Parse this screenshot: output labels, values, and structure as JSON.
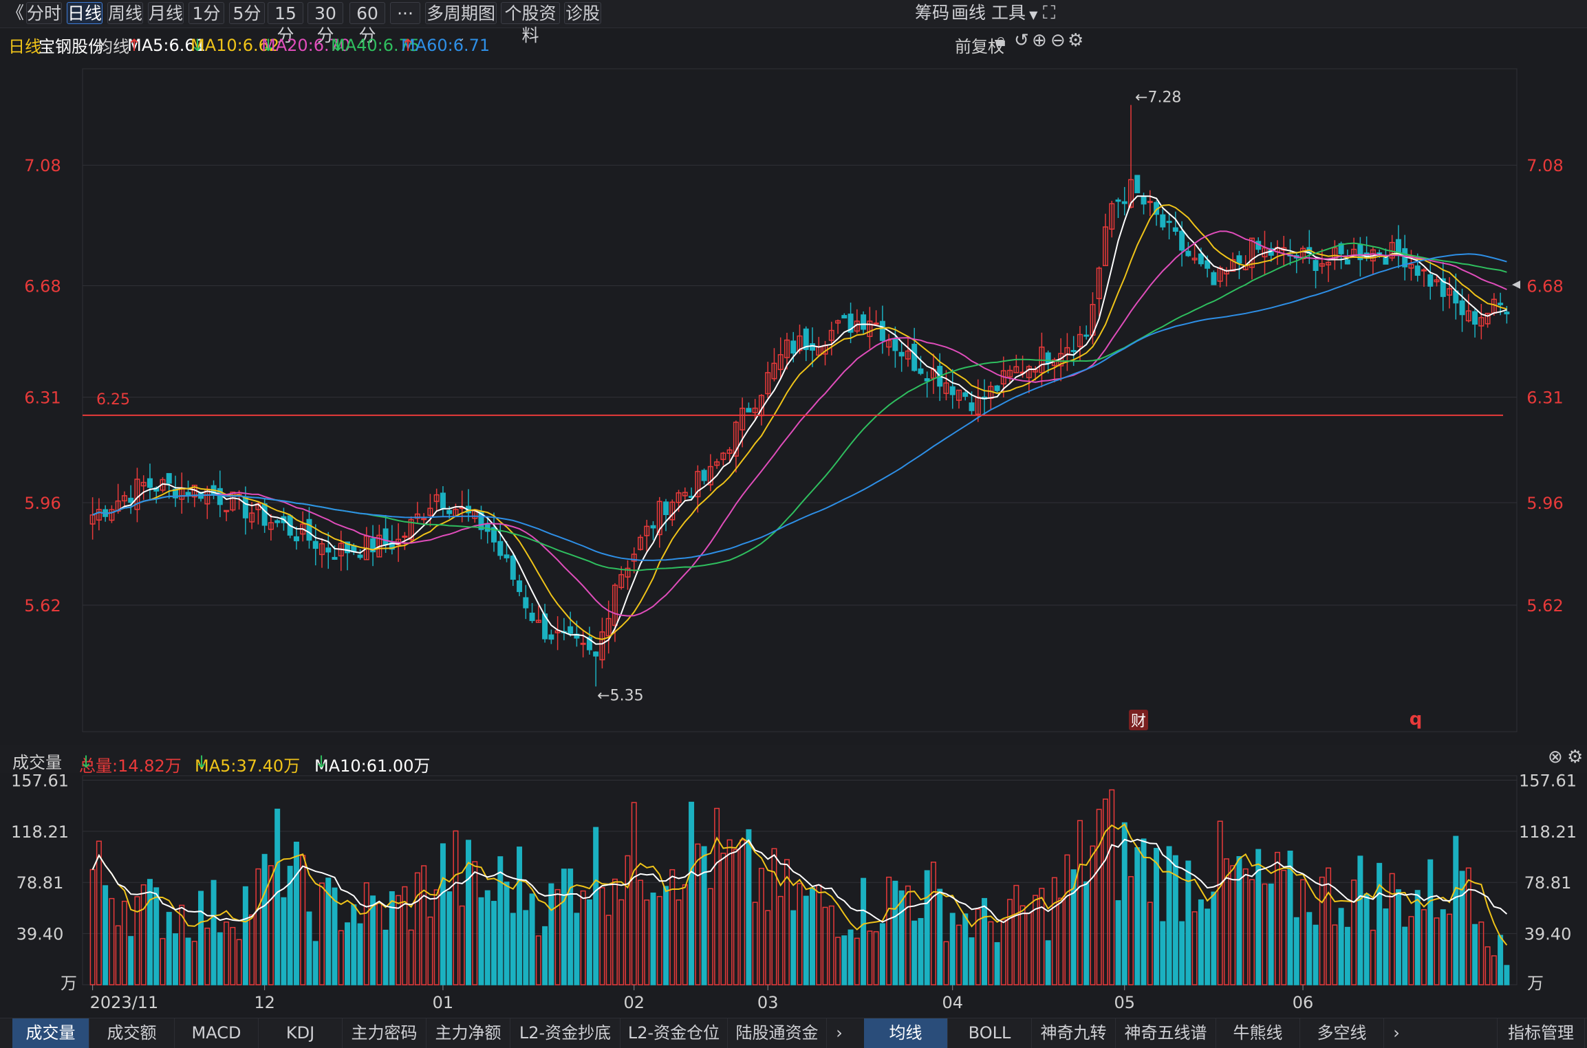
{
  "toolbar": {
    "back": "《",
    "tabs": [
      "分时",
      "日线",
      "周线",
      "月线",
      "1分",
      "5分",
      "15分",
      "30分",
      "60分",
      "···",
      "多周期图",
      "个股资料",
      "诊股"
    ],
    "active_tab": "日线",
    "right": [
      "筹码",
      "画线",
      "工具"
    ]
  },
  "info": {
    "period": "日线",
    "stock": "宝钢股份",
    "ma_label": "均线",
    "ma5": "MA5:6.61",
    "ma10": "MA10:6.62",
    "ma20": "MA20:6.70",
    "ma40": "MA40:6.75",
    "ma60": "MA60:6.71",
    "fq": "前复权"
  },
  "colors": {
    "up": "#e83a3a",
    "down": "#1bb1c1",
    "ma5": "#ffffff",
    "ma10": "#f0c419",
    "ma20": "#e04dbb",
    "ma40": "#2fbf5f",
    "ma60": "#2e8fe6",
    "bg": "#1b1c20"
  },
  "price_axis": [
    "7.08",
    "6.68",
    "6.31",
    "5.96",
    "5.62"
  ],
  "annotations": {
    "high": "←7.28",
    "low": "←5.35",
    "line": "6.25",
    "cai": "财",
    "q": "q"
  },
  "volume": {
    "label": "成交量",
    "total": "总量:14.82万",
    "ma5": "MA5:37.40万",
    "ma10": "MA10:61.00万",
    "axis": [
      "157.61",
      "118.21",
      "78.81",
      "39.40",
      "万"
    ]
  },
  "xaxis": [
    "2023/11",
    "12",
    "01",
    "02",
    "03",
    "04",
    "05",
    "06"
  ],
  "bottom_tabs_left": [
    "成交量",
    "成交额",
    "MACD",
    "KDJ",
    "主力密码",
    "主力净额",
    "L2-资金抄底",
    "L2-资金仓位",
    "陆股通资金"
  ],
  "bottom_tabs_right": [
    "均线",
    "BOLL",
    "神奇九转",
    "神奇五线谱",
    "牛熊线",
    "多空线"
  ],
  "bottom_right": "指标管理",
  "chart_data": {
    "type": "candlestick",
    "title": "宝钢股份 日线",
    "price_ylim": [
      5.2,
      7.4
    ],
    "price_ticks": [
      7.08,
      6.68,
      6.31,
      5.96,
      5.62
    ],
    "high_label": 7.28,
    "low_label": 5.35,
    "hline": 6.25,
    "ma_last": {
      "MA5": 6.61,
      "MA10": 6.62,
      "MA20": 6.7,
      "MA40": 6.75,
      "MA60": 6.71
    },
    "volume_unit": "万",
    "volume_ylim": [
      0,
      160
    ],
    "volume_ticks": [
      157.61,
      118.21,
      78.81,
      39.4
    ],
    "close_anchors": [
      [
        0,
        5.92
      ],
      [
        8,
        6.02
      ],
      [
        18,
        6.0
      ],
      [
        30,
        5.88
      ],
      [
        38,
        5.8
      ],
      [
        48,
        5.83
      ],
      [
        54,
        5.99
      ],
      [
        62,
        5.87
      ],
      [
        70,
        5.55
      ],
      [
        79,
        5.44
      ],
      [
        82,
        5.7
      ],
      [
        90,
        5.96
      ],
      [
        97,
        6.05
      ],
      [
        103,
        6.28
      ],
      [
        109,
        6.47
      ],
      [
        115,
        6.52
      ],
      [
        122,
        6.58
      ],
      [
        128,
        6.44
      ],
      [
        133,
        6.38
      ],
      [
        139,
        6.29
      ],
      [
        145,
        6.4
      ],
      [
        152,
        6.48
      ],
      [
        156,
        6.52
      ],
      [
        160,
        6.95
      ],
      [
        163,
        7.0
      ],
      [
        170,
        6.83
      ],
      [
        176,
        6.68
      ],
      [
        182,
        6.8
      ],
      [
        188,
        6.78
      ],
      [
        194,
        6.76
      ],
      [
        200,
        6.8
      ],
      [
        206,
        6.78
      ],
      [
        212,
        6.66
      ],
      [
        216,
        6.57
      ],
      [
        222,
        6.62
      ]
    ],
    "volume_anchors": [
      [
        0,
        85
      ],
      [
        8,
        60
      ],
      [
        16,
        55
      ],
      [
        22,
        60
      ],
      [
        26,
        70
      ],
      [
        30,
        104
      ],
      [
        34,
        58
      ],
      [
        40,
        62
      ],
      [
        46,
        55
      ],
      [
        50,
        65
      ],
      [
        56,
        90
      ],
      [
        62,
        70
      ],
      [
        66,
        82
      ],
      [
        72,
        60
      ],
      [
        76,
        90
      ],
      [
        82,
        95
      ],
      [
        88,
        102
      ],
      [
        92,
        108
      ],
      [
        96,
        105
      ],
      [
        100,
        90
      ],
      [
        104,
        82
      ],
      [
        108,
        70
      ],
      [
        114,
        62
      ],
      [
        118,
        58
      ],
      [
        124,
        64
      ],
      [
        128,
        75
      ],
      [
        132,
        68
      ],
      [
        136,
        52
      ],
      [
        140,
        48
      ],
      [
        146,
        55
      ],
      [
        150,
        60
      ],
      [
        154,
        85
      ],
      [
        158,
        120
      ],
      [
        162,
        98
      ],
      [
        166,
        90
      ],
      [
        170,
        82
      ],
      [
        176,
        90
      ],
      [
        182,
        76
      ],
      [
        188,
        72
      ],
      [
        194,
        70
      ],
      [
        200,
        75
      ],
      [
        206,
        66
      ],
      [
        212,
        72
      ],
      [
        216,
        100
      ],
      [
        219,
        50
      ],
      [
        222,
        14.82
      ]
    ],
    "n_bars": 223
  }
}
